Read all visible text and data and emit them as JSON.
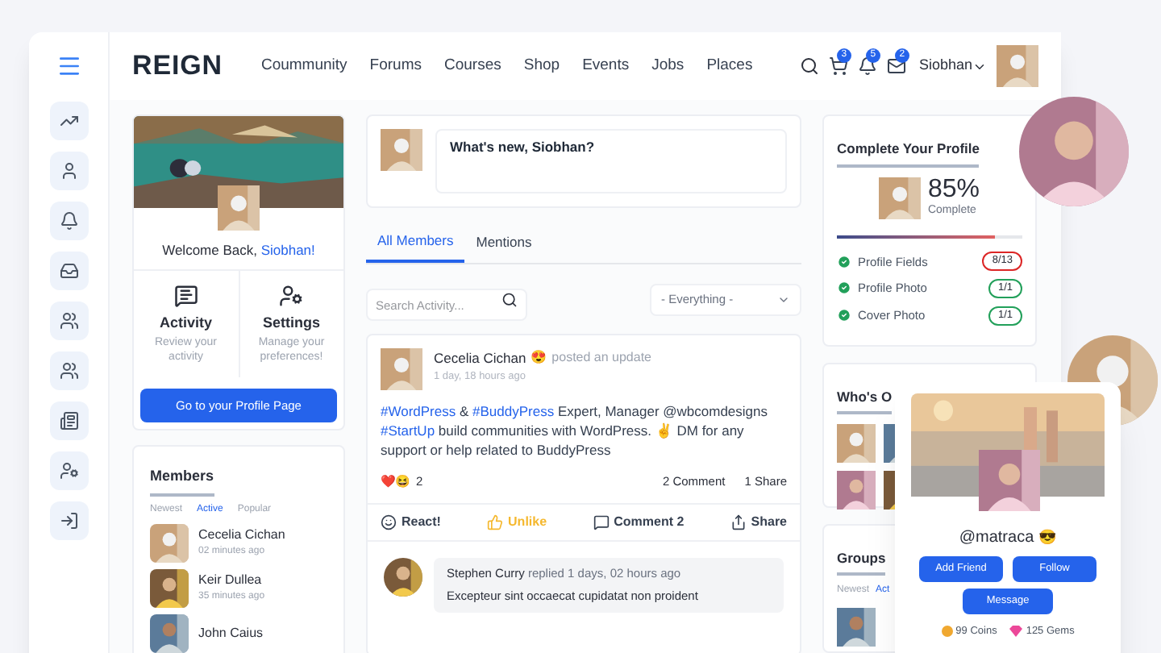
{
  "brand": "REIGN",
  "nav": [
    "Coummunity",
    "Forums",
    "Courses",
    "Shop",
    "Events",
    "Jobs",
    "Places"
  ],
  "header": {
    "badges": [
      "3",
      "5",
      "2"
    ],
    "user_name": "Siobhan"
  },
  "welcome": {
    "greeting": "Welcome Back,",
    "name": "Siobhan!"
  },
  "quick_links": [
    {
      "kind": "activity",
      "title": "Activity",
      "description": "Review your activity"
    },
    {
      "kind": "settings",
      "title": "Settings",
      "description": "Manage your preferences!"
    }
  ],
  "profile_button": "Go to your Profile Page",
  "members": {
    "title": "Members",
    "tabs": [
      {
        "label": "Newest",
        "selected": false
      },
      {
        "label": "Active",
        "selected": true
      },
      {
        "label": "Popular",
        "selected": false
      }
    ],
    "list": [
      {
        "name": "Cecelia Cichan",
        "time": "02 minutes ago"
      },
      {
        "name": "Keir Dullea",
        "time": "35 minutes ago"
      },
      {
        "name": "John Caius"
      }
    ]
  },
  "composer": {
    "placeholder": "What's new, Siobhan?"
  },
  "feed_tabs": [
    {
      "label": "All Members",
      "selected": true
    },
    {
      "label": "Mentions",
      "selected": false
    }
  ],
  "search": {
    "placeholder": "Search Activity..."
  },
  "filter": "- Everything -",
  "post": {
    "author": "Cecelia Cichan",
    "emoji": "😍",
    "action": "posted an update",
    "time": "1 day, 18 hours ago",
    "body": [
      {
        "kind": "tag",
        "text": "#WordPress"
      },
      {
        "kind": "plain",
        "text": " & "
      },
      {
        "kind": "tag",
        "text": "#BuddyPress"
      },
      {
        "kind": "plain",
        "text": " Expert, Manager @wbcomdesigns"
      },
      {
        "kind": "break"
      },
      {
        "kind": "tag",
        "text": "#StartUp"
      },
      {
        "kind": "plain",
        "text": " build communities with WordPress. ✌ DM for any support or help related to BuddyPress"
      }
    ],
    "reactions": "❤️😆",
    "reaction_count": "2",
    "comments": "2 Comment",
    "shares": "1 Share",
    "actions": [
      {
        "kind": "react",
        "label": "React!"
      },
      {
        "kind": "like",
        "label": "Unlike",
        "active": true
      },
      {
        "kind": "comment",
        "label": "Comment 2"
      },
      {
        "kind": "share",
        "label": "Share"
      }
    ]
  },
  "reply": {
    "author": "Stephen Curry",
    "meta": "replied 1 days, 02 hours ago",
    "text": "Excepteur sint occaecat cupidatat non proident"
  },
  "profile_completion": {
    "title": "Complete Your Profile",
    "percent": "85%",
    "label": "Complete",
    "level": 0.85,
    "items": [
      {
        "label": "Profile Fields",
        "count": "8/13",
        "complete": false
      },
      {
        "label": "Profile Photo",
        "count": "1/1",
        "complete": true
      },
      {
        "label": "Cover Photo",
        "count": "1/1",
        "complete": true
      }
    ]
  },
  "whos_online": {
    "title": "Who's O"
  },
  "groups": {
    "title": "Groups",
    "tabs": [
      {
        "label": "Newest",
        "selected": false
      },
      {
        "label": "Act",
        "selected": true
      }
    ]
  },
  "profile_card": {
    "handle": "@matraca",
    "emoji": "😎",
    "buttons": [
      "Add Friend",
      "Follow",
      "Message"
    ],
    "coins": "99 Coins",
    "gems": "125 Gems"
  }
}
